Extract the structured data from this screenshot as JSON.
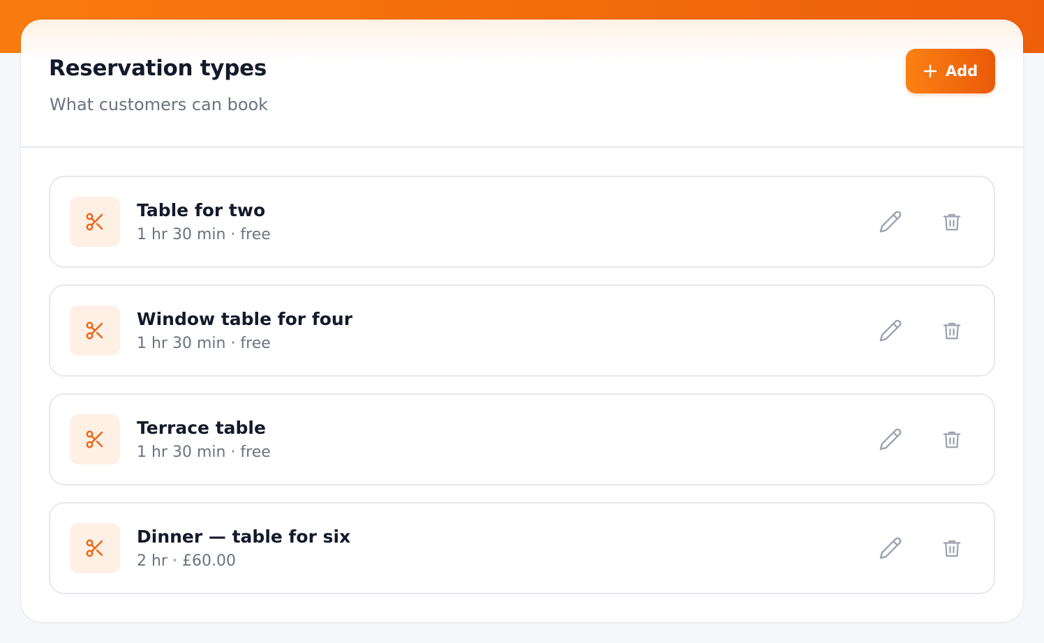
{
  "colors": {
    "accent": "#f47216",
    "accent_dark": "#ea5a09",
    "icon_bg": "#fff0e5",
    "title_text": "#131a2b",
    "muted_text": "#6b7280",
    "action_icon": "#9ca3af",
    "border": "#e6e8ec"
  },
  "header": {
    "title": "Reservation types",
    "subtitle": "What customers can book",
    "add_button": {
      "icon": "plus-icon",
      "label": "Add"
    }
  },
  "reservation_types": [
    {
      "name": "Table for two",
      "meta": "1 hr 30 min · free",
      "icon": "scissors-icon"
    },
    {
      "name": "Window table for four",
      "meta": "1 hr 30 min · free",
      "icon": "scissors-icon"
    },
    {
      "name": "Terrace table",
      "meta": "1 hr 30 min · free",
      "icon": "scissors-icon"
    },
    {
      "name": "Dinner — table for six",
      "meta": "2 hr · £60.00",
      "icon": "scissors-icon"
    }
  ],
  "actions": {
    "edit_icon": "pencil-icon",
    "delete_icon": "trash-icon"
  }
}
